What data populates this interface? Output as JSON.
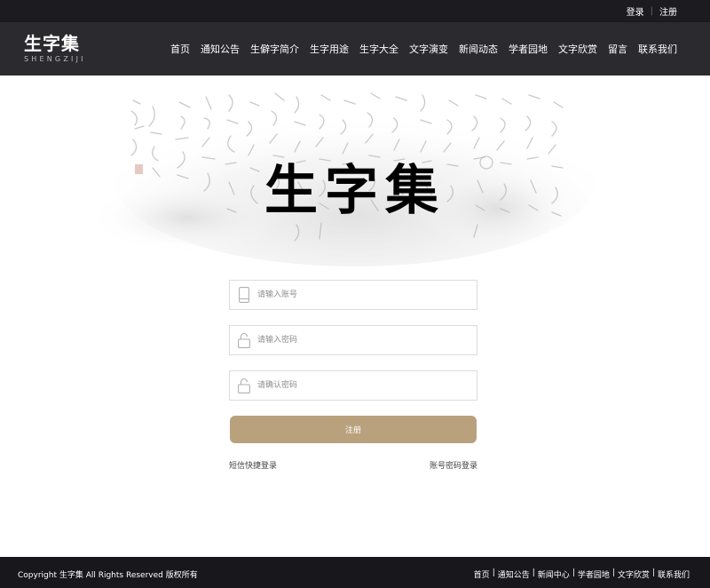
{
  "topbar": {
    "login": "登录",
    "register": "注册"
  },
  "logo": {
    "name": "生字集",
    "pinyin": "SHENGZIJI"
  },
  "nav": [
    "首页",
    "通知公告",
    "生僻字简介",
    "生字用途",
    "生字大全",
    "文字演变",
    "新闻动态",
    "学者园地",
    "文字欣赏",
    "留言",
    "联系我们"
  ],
  "banner": {
    "calligraphy_title": "生字集"
  },
  "form": {
    "account_placeholder": "请输入账号",
    "password_placeholder": "请输入密码",
    "confirm_placeholder": "请确认密码",
    "submit_label": "注册",
    "sms_login": "短信快捷登录",
    "password_login": "账号密码登录"
  },
  "footer": {
    "copyright": "Copyright 生字集 All Rights Reserved 版权所有",
    "links": [
      "首页",
      "通知公告",
      "新闻中心",
      "学者园地",
      "文字欣赏",
      "联系我们"
    ]
  },
  "colors": {
    "accent": "#b9a17d",
    "header": "#2a2a2f",
    "topbar": "#1c1c20",
    "footer": "#18171c"
  },
  "icons": {
    "account": "phone-icon",
    "password": "lock-icon",
    "confirm": "lock-icon"
  }
}
